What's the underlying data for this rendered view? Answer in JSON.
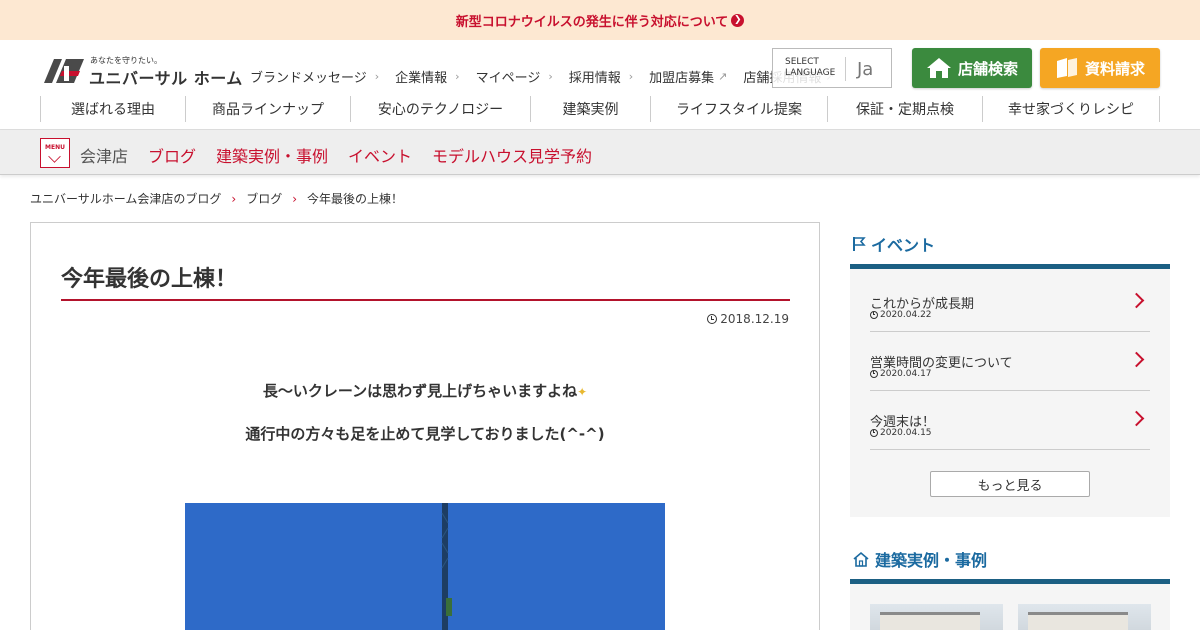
{
  "notice": {
    "text": "新型コロナウイルスの発生に伴う対応について",
    "icon": "chevron-circle-right-icon"
  },
  "header": {
    "logo_tagline": "あなたを守りたい。",
    "logo_name": "ユニバーサル ホーム",
    "top_nav": [
      {
        "label": "ブランドメッセージ",
        "icon": "chevron-right-icon"
      },
      {
        "label": "企業情報",
        "icon": "chevron-right-icon"
      },
      {
        "label": "マイページ",
        "icon": "chevron-right-icon"
      },
      {
        "label": "採用情報",
        "icon": "chevron-right-icon"
      },
      {
        "label": "加盟店募集",
        "icon": "external-link-icon"
      },
      {
        "label": "店舗採用情報",
        "icon": "external-link-icon"
      }
    ],
    "language": {
      "label_line1": "SELECT",
      "label_line2": "LANGUAGE",
      "value": "Ja"
    },
    "store_search_label": "店舗検索",
    "request_docs_label": "資料請求",
    "main_nav": [
      "選ばれる理由",
      "商品ラインナップ",
      "安心のテクノロジー",
      "建築実例",
      "ライフスタイル提案",
      "保証・定期点検",
      "幸せ家づくりレシピ"
    ]
  },
  "subnav": {
    "menu_label": "MENU",
    "store_name": "会津店",
    "links": [
      "ブログ",
      "建築実例・事例",
      "イベント",
      "モデルハウス見学予約"
    ]
  },
  "breadcrumb": [
    "ユニバーサルホーム会津店のブログ",
    "ブログ",
    "今年最後の上棟！"
  ],
  "article": {
    "title": "今年最後の上棟！",
    "date": "2018.12.19",
    "paragraph1": "長～いクレーンは思わず見上げちゃいますよね",
    "paragraph2": "通行中の方々も足を止めて見学しておりました(^-^)"
  },
  "sidebar": {
    "events_title": "イベント",
    "events": [
      {
        "title": "これからが成長期",
        "date": "2020.04.22"
      },
      {
        "title": "営業時間の変更について",
        "date": "2020.04.17"
      },
      {
        "title": "今週末は！",
        "date": "2020.04.15"
      }
    ],
    "more_label": "もっと見る",
    "cases_title": "建築実例・事例"
  },
  "colors": {
    "accent": "#c8102e",
    "green": "#3b8a3e",
    "orange": "#f5a623",
    "navy": "#1b5f83",
    "notice_bg": "#fde8d2"
  }
}
